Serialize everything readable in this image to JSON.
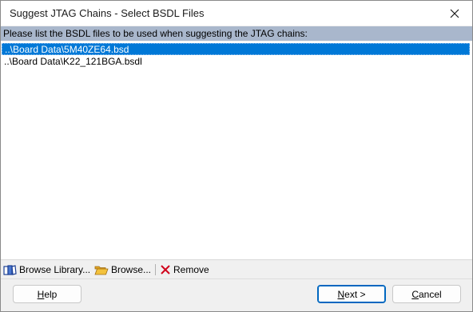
{
  "window": {
    "title": "Suggest JTAG Chains - Select BSDL Files"
  },
  "prompt": "Please list the BSDL files to be used when suggesting the JTAG chains:",
  "files": [
    {
      "path": "..\\Board Data\\5M40ZE64.bsd"
    },
    {
      "path": "..\\Board Data\\K22_121BGA.bsdl"
    }
  ],
  "toolbar": {
    "browse_library": "Browse Library...",
    "browse": "Browse...",
    "remove": "Remove"
  },
  "buttons": {
    "help": {
      "accel": "H",
      "rest": "elp"
    },
    "next": {
      "accel": "N",
      "rest": "ext >"
    },
    "cancel": {
      "accel": "C",
      "rest": "ancel"
    }
  },
  "colors": {
    "selection": "#0078d7",
    "header_bar": "#a9b7cc",
    "remove_icon": "#d0021b",
    "folder_icon": "#f3c23c"
  },
  "icons": {
    "close": "close-icon",
    "library": "library-icon",
    "folder": "folder-open-icon",
    "remove": "remove-x-icon"
  }
}
